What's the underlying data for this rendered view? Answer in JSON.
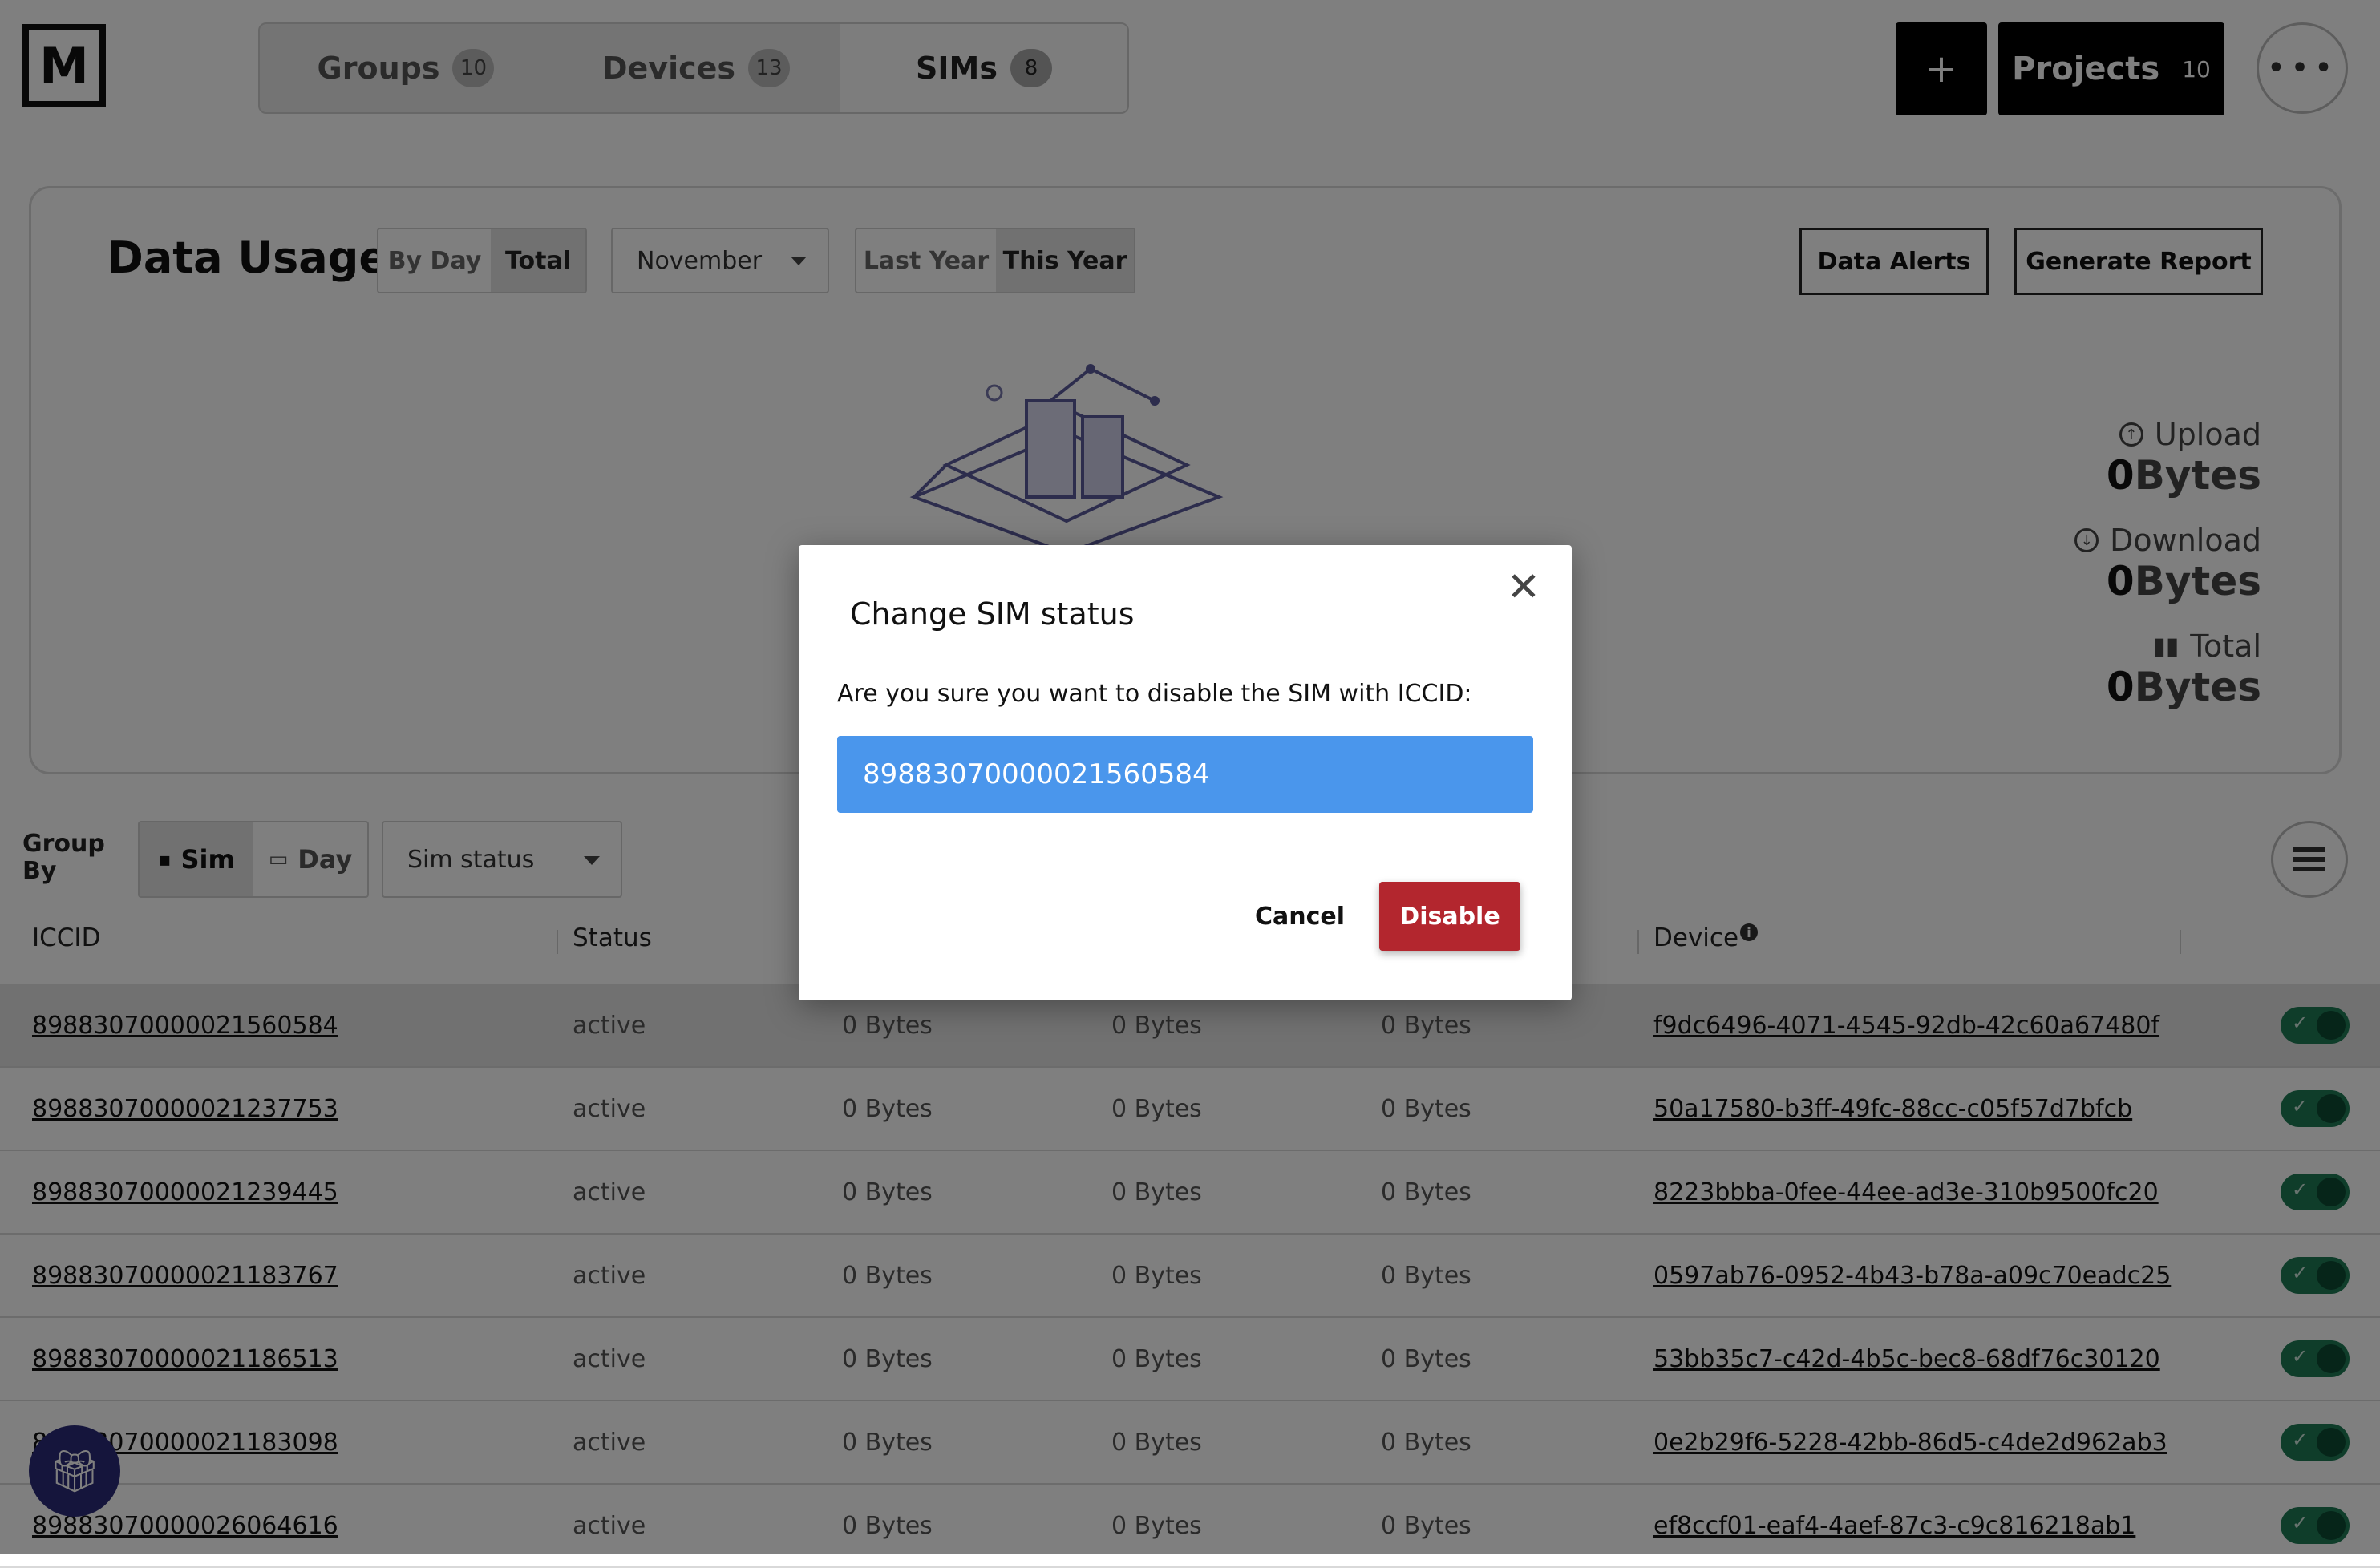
{
  "logo": "M",
  "tabs": [
    {
      "label": "Groups",
      "count": "10"
    },
    {
      "label": "Devices",
      "count": "13"
    },
    {
      "label": "SIMs",
      "count": "8"
    }
  ],
  "header": {
    "add_label": "+",
    "projects_label": "Projects",
    "projects_count": "10",
    "more_label": "•••"
  },
  "data_usage": {
    "title": "Data Usage",
    "view_toggle": [
      "By Day",
      "Total"
    ],
    "month_select": "November",
    "period_toggle": [
      "Last Year",
      "This Year"
    ],
    "data_alerts_label": "Data Alerts",
    "generate_report_label": "Generate Report",
    "stats": [
      {
        "label": "Upload",
        "num": "0",
        "unit": "Bytes"
      },
      {
        "label": "Download",
        "num": "0",
        "unit": "Bytes"
      },
      {
        "label": "Total",
        "num": "0",
        "unit": "Bytes"
      }
    ]
  },
  "group_by": {
    "label_line1": "Group",
    "label_line2": "By",
    "options": [
      "Sim",
      "Day"
    ],
    "status_select": "Sim status"
  },
  "table": {
    "headers": {
      "iccid": "ICCID",
      "status": "Status",
      "device": "Device"
    },
    "rows": [
      {
        "iccid": "89883070000021560584",
        "status": "active",
        "c1": "0 Bytes",
        "c2": "0 Bytes",
        "c3": "0 Bytes",
        "device": "f9dc6496-4071-4545-92db-42c60a67480f"
      },
      {
        "iccid": "89883070000021237753",
        "status": "active",
        "c1": "0 Bytes",
        "c2": "0 Bytes",
        "c3": "0 Bytes",
        "device": "50a17580-b3ff-49fc-88cc-c05f57d7bfcb"
      },
      {
        "iccid": "89883070000021239445",
        "status": "active",
        "c1": "0 Bytes",
        "c2": "0 Bytes",
        "c3": "0 Bytes",
        "device": "8223bbba-0fee-44ee-ad3e-310b9500fc20"
      },
      {
        "iccid": "89883070000021183767",
        "status": "active",
        "c1": "0 Bytes",
        "c2": "0 Bytes",
        "c3": "0 Bytes",
        "device": "0597ab76-0952-4b43-b78a-a09c70eadc25"
      },
      {
        "iccid": "89883070000021186513",
        "status": "active",
        "c1": "0 Bytes",
        "c2": "0 Bytes",
        "c3": "0 Bytes",
        "device": "53bb35c7-c42d-4b5c-bec8-68df76c30120"
      },
      {
        "iccid": "89883070000021183098",
        "status": "active",
        "c1": "0 Bytes",
        "c2": "0 Bytes",
        "c3": "0 Bytes",
        "device": "0e2b29f6-5228-42bb-86d5-c4de2d962ab3"
      },
      {
        "iccid": "89883070000026064616",
        "status": "active",
        "c1": "0 Bytes",
        "c2": "0 Bytes",
        "c3": "0 Bytes",
        "device": "ef8ccf01-eaf4-4aef-87c3-c9c816218ab1"
      }
    ]
  },
  "modal": {
    "title": "Change SIM status",
    "message": "Are you sure you want to disable the SIM with ICCID:",
    "iccid": "89883070000021560584",
    "cancel_label": "Cancel",
    "disable_label": "Disable"
  },
  "colors": {
    "accent_blue": "#4a96ec",
    "danger": "#b3262e",
    "toggle_on": "#1f7a55",
    "gift": "#2a2a78"
  },
  "icons": {
    "close": "close-icon",
    "gift": "gift-icon",
    "list": "list-icon",
    "info": "info-icon"
  }
}
